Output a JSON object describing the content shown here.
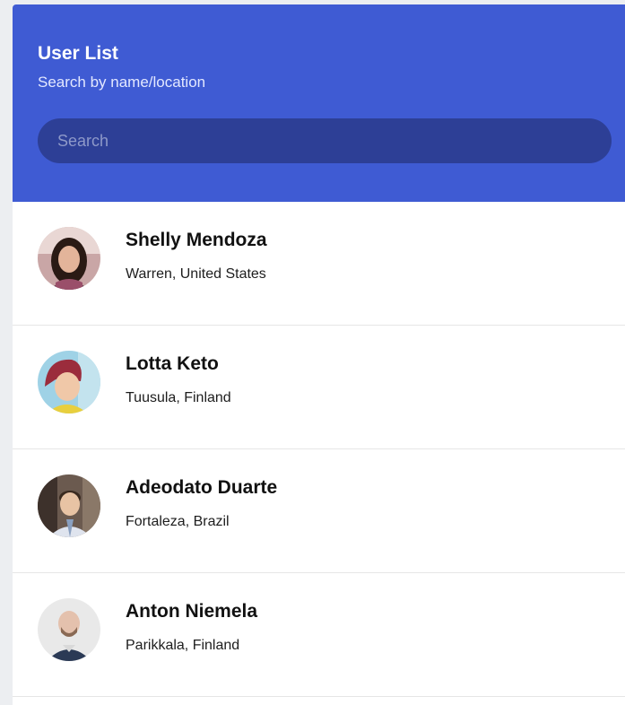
{
  "header": {
    "title": "User List",
    "subtitle": "Search by name/location"
  },
  "search": {
    "placeholder": "Search",
    "value": ""
  },
  "colors": {
    "header_bg": "#3f5bd3",
    "search_bg": "#2d3f96",
    "page_bg": "#eceef1"
  },
  "users": [
    {
      "name": "Shelly Mendoza",
      "location": "Warren, United States",
      "avatar_icon": "user-photo-icon"
    },
    {
      "name": "Lotta Keto",
      "location": "Tuusula, Finland",
      "avatar_icon": "user-photo-icon"
    },
    {
      "name": "Adeodato Duarte",
      "location": "Fortaleza, Brazil",
      "avatar_icon": "user-photo-icon"
    },
    {
      "name": "Anton Niemela",
      "location": "Parikkala, Finland",
      "avatar_icon": "user-photo-icon"
    }
  ]
}
